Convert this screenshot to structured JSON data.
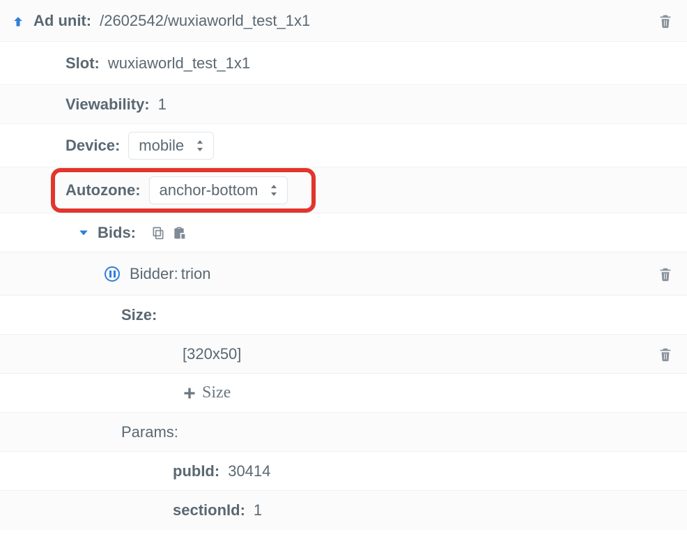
{
  "adunit": {
    "label": "Ad unit:",
    "value": "/2602542/wuxiaworld_test_1x1"
  },
  "slot": {
    "label": "Slot:",
    "value": "wuxiaworld_test_1x1"
  },
  "viewability": {
    "label": "Viewability:",
    "value": "1"
  },
  "device": {
    "label": "Device:",
    "value": "mobile"
  },
  "autozone": {
    "label": "Autozone:",
    "value": "anchor-bottom"
  },
  "bids": {
    "label": "Bids:"
  },
  "bidder": {
    "label": "Bidder:",
    "value": "trion"
  },
  "size": {
    "label": "Size:",
    "value": "[320x50]",
    "add_label": "Size"
  },
  "params": {
    "label": "Params:",
    "pubId": {
      "label": "pubId:",
      "value": "30414"
    },
    "sectionId": {
      "label": "sectionId:",
      "value": "1"
    }
  }
}
